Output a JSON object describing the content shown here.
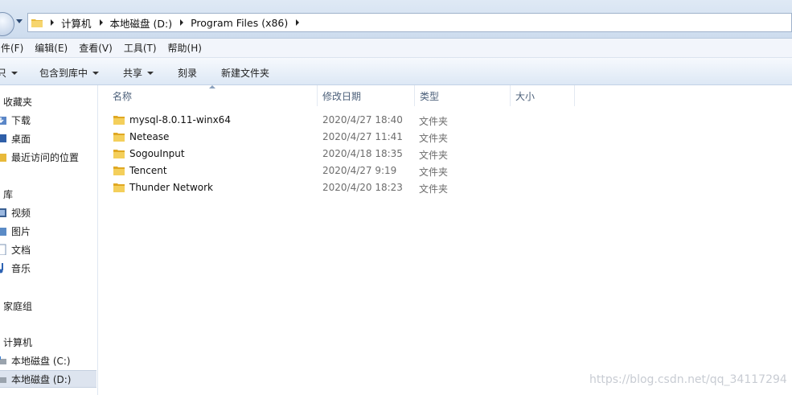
{
  "address": {
    "crumbs": [
      "计算机",
      "本地磁盘 (D:)",
      "Program Files (x86)"
    ]
  },
  "menu": [
    "件(F)",
    "编辑(E)",
    "查看(V)",
    "工具(T)",
    "帮助(H)"
  ],
  "toolbar": {
    "organize": "只",
    "include_in_library": "包含到库中",
    "share": "共享",
    "burn": "刻录",
    "new_folder": "新建文件夹"
  },
  "nav": {
    "favorites": "收藏夹",
    "downloads": "下载",
    "desktop": "桌面",
    "recent": "最近访问的位置",
    "libraries": "库",
    "videos": "视频",
    "pictures": "图片",
    "documents": "文档",
    "music": "音乐",
    "homegroup": "家庭组",
    "computer": "计算机",
    "drive_c": "本地磁盘 (C:)",
    "drive_d": "本地磁盘 (D:)"
  },
  "columns": {
    "name": "名称",
    "modified": "修改日期",
    "type": "类型",
    "size": "大小"
  },
  "files": [
    {
      "name": "mysql-8.0.11-winx64",
      "modified": "2020/4/27 18:40",
      "type": "文件夹"
    },
    {
      "name": "Netease",
      "modified": "2020/4/27 11:41",
      "type": "文件夹"
    },
    {
      "name": "SogouInput",
      "modified": "2020/4/18 18:35",
      "type": "文件夹"
    },
    {
      "name": "Tencent",
      "modified": "2020/4/27 9:19",
      "type": "文件夹"
    },
    {
      "name": "Thunder Network",
      "modified": "2020/4/20 18:23",
      "type": "文件夹"
    }
  ],
  "watermark": "https://blog.csdn.net/qq_34117294",
  "colors": {
    "folder": "#e8b93a",
    "selected": "#dde4ef",
    "accent": "#2d4a73"
  }
}
